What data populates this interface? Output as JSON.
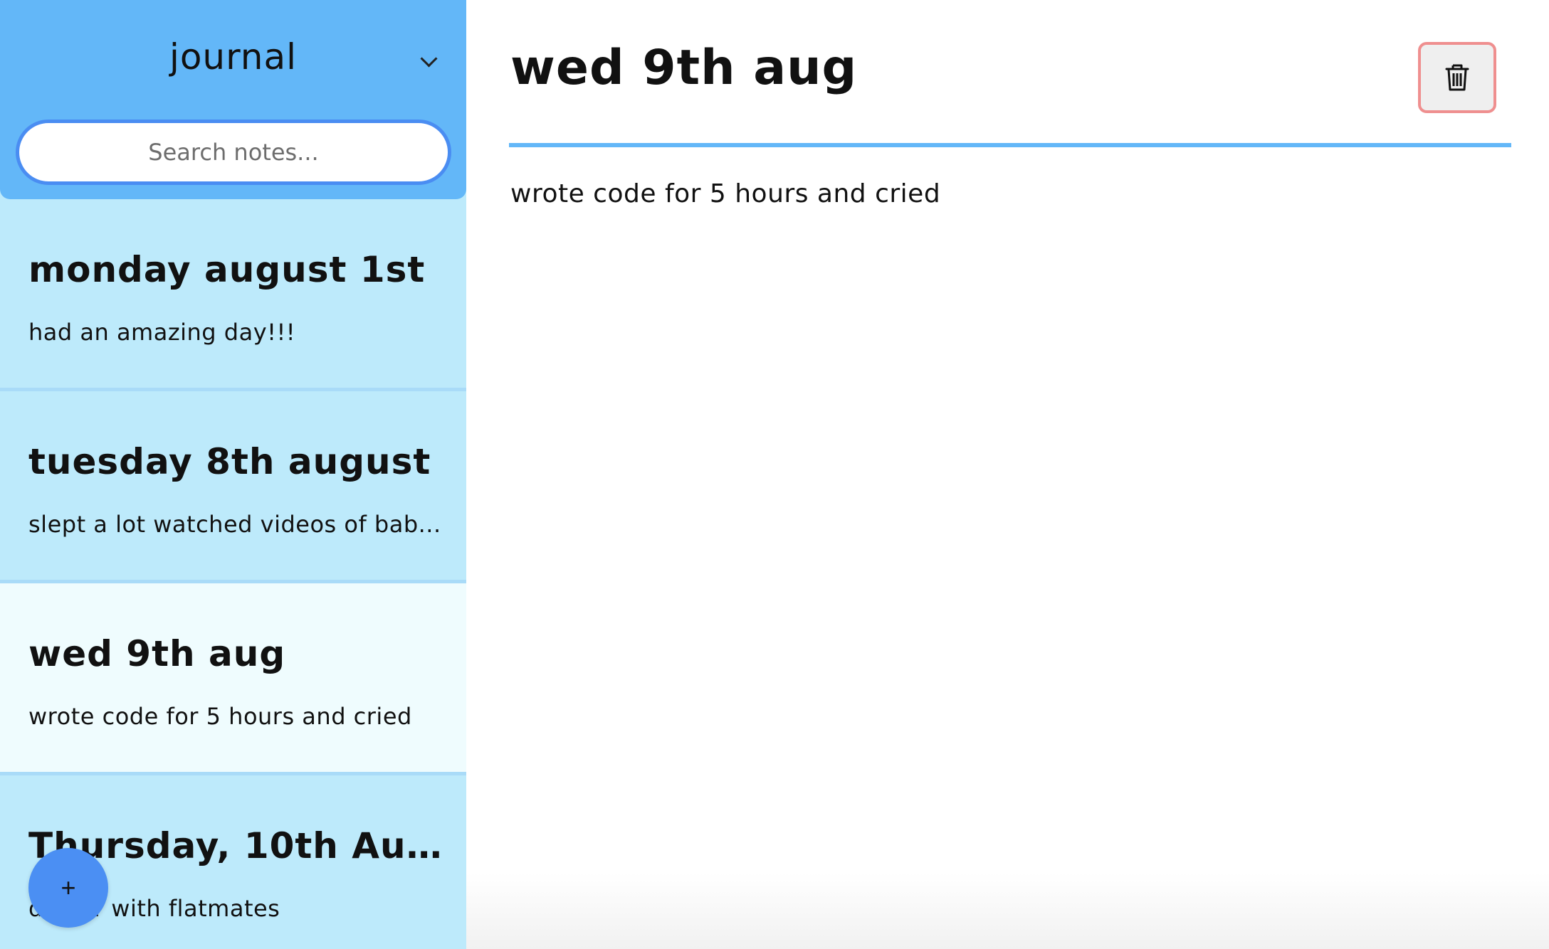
{
  "sidebar": {
    "notebook": {
      "title": "journal"
    },
    "search": {
      "placeholder": "Search notes..."
    },
    "notes": [
      {
        "title": "monday august 1st",
        "preview": "had an amazing day!!!"
      },
      {
        "title": "tuesday 8th august",
        "preview": "slept a lot watched videos of bab..."
      },
      {
        "title": "wed 9th aug",
        "preview": "wrote code for 5 hours and cried"
      },
      {
        "title": "Thursday, 10th Augus...",
        "preview": "dinner with flatmates"
      }
    ],
    "active_index": 2,
    "add_label": "+"
  },
  "main": {
    "title": "wed 9th aug",
    "body": "wrote code for 5 hours and cried",
    "delete_icon": "trash-icon"
  },
  "colors": {
    "header_blue": "#63b7f8",
    "list_blue": "#bdeafb",
    "active_item": "#effcfe",
    "accent": "#4b8ff3",
    "delete_border": "#ef8f8f"
  }
}
